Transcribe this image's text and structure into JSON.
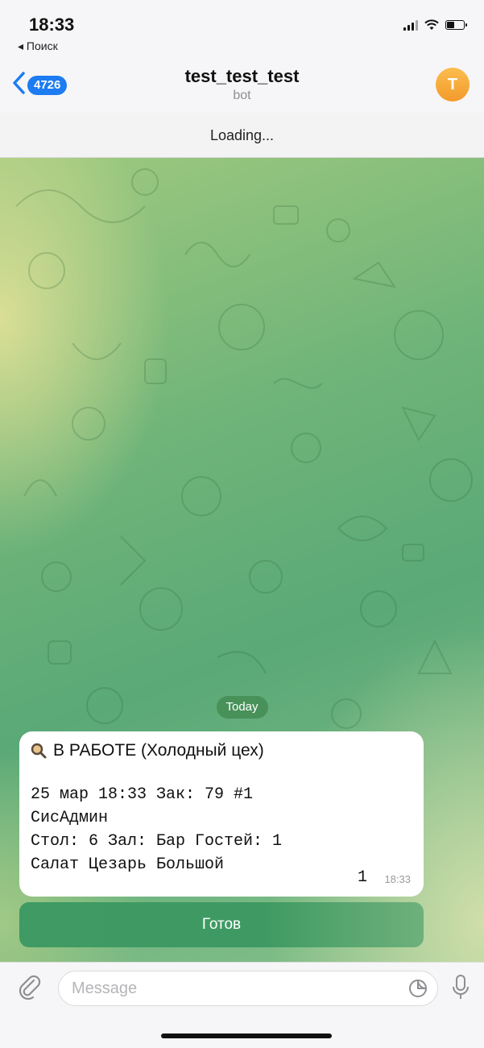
{
  "status_bar": {
    "time": "18:33",
    "back_app": "◂ Поиск"
  },
  "nav": {
    "unread_count": "4726",
    "title": "test_test_test",
    "subtitle": "bot",
    "avatar_letter": "T"
  },
  "loading_text": "Loading...",
  "date_separator": "Today",
  "message": {
    "status_line": "В РАБОТЕ (Холодный цех)",
    "lines": [
      "25 мар 18:33 Зак: 79 #1",
      "СисАдмин",
      "Стол: 6 Зал: Бар Гостей: 1",
      "Салат Цезарь Большой"
    ],
    "quantity": "1",
    "time": "18:33"
  },
  "inline_button": {
    "label": "Готов"
  },
  "composer": {
    "placeholder": "Message"
  },
  "icons": {
    "back": "chevron-left-icon",
    "attach": "paperclip-icon",
    "sticker": "sticker-icon",
    "mic": "microphone-icon",
    "status": "magnifier-icon"
  },
  "colors": {
    "accent": "#1d7cf2",
    "button_green": "#3f9a63",
    "avatar_orange": "#f39a2c"
  }
}
